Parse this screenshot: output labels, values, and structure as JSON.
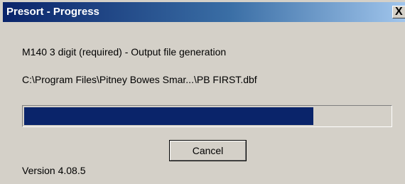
{
  "window": {
    "title": "Presort - Progress",
    "close_glyph": "X"
  },
  "status": {
    "operation": "M140 3 digit (required) - Output file generation",
    "file_path": "C:\\Program Files\\Pitney Bowes Smar...\\PB FIRST.dbf"
  },
  "progress": {
    "fraction": 0.79
  },
  "buttons": {
    "cancel_label": "Cancel"
  },
  "footer": {
    "version": "Version  4.08.5"
  },
  "colors": {
    "title_bar": "#0a246a",
    "progress_fill": "#0a246a",
    "dialog_face": "#d4d0c8"
  },
  "icons": {
    "close": "close-icon"
  }
}
